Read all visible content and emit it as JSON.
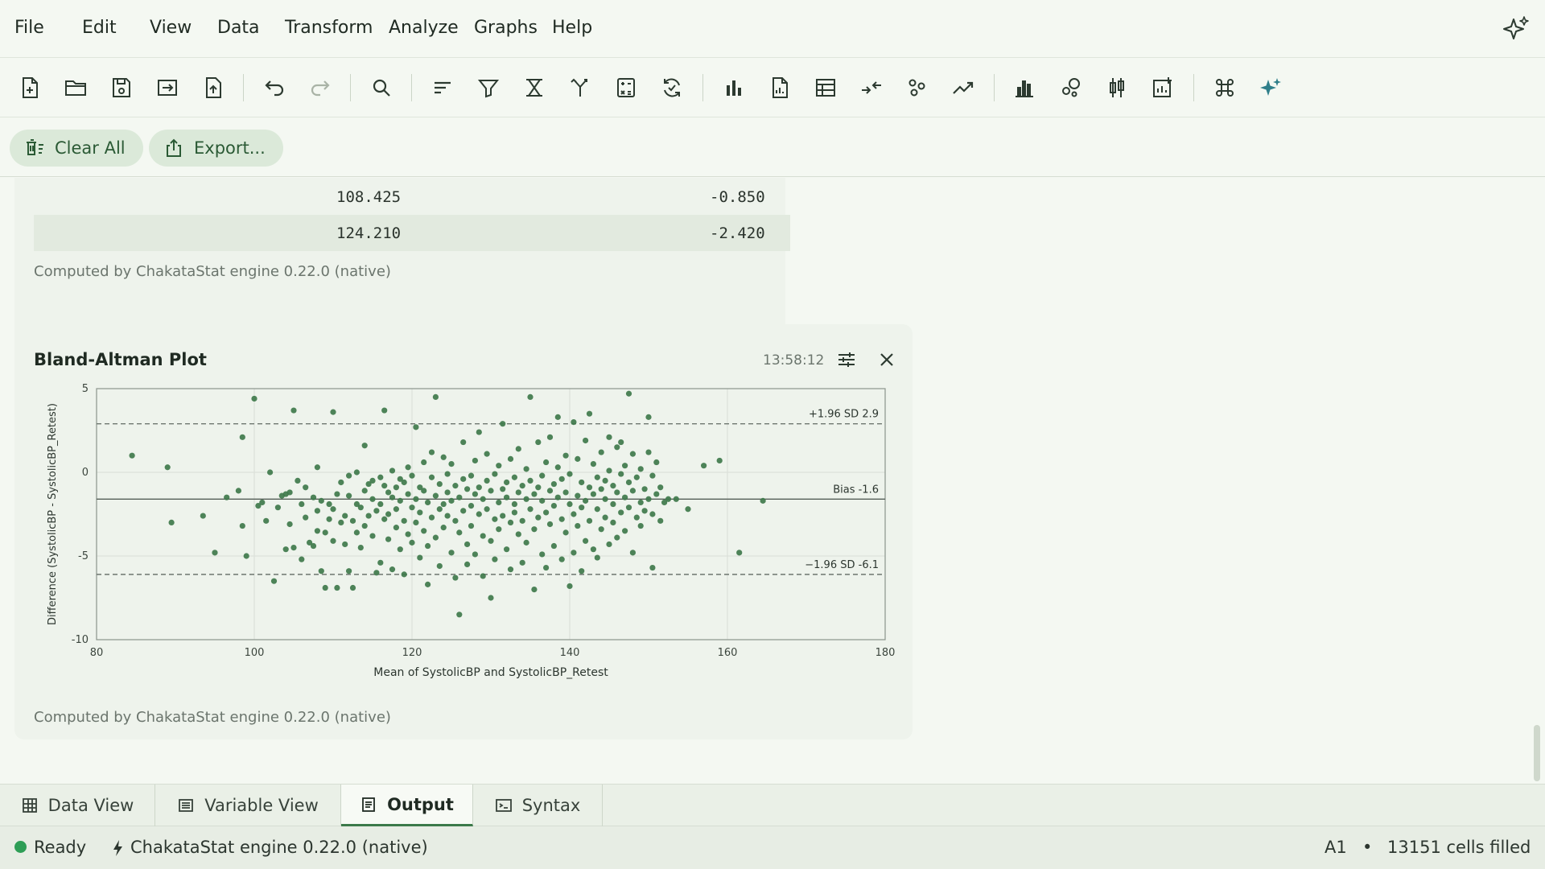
{
  "menu": [
    "File",
    "Edit",
    "View",
    "Data",
    "Transform",
    "Analyze",
    "Graphs",
    "Help"
  ],
  "toolbar_icons": [
    "new-file-icon",
    "open-folder-icon",
    "save-icon",
    "import-icon",
    "export-icon",
    "undo-icon",
    "redo-icon",
    "find-icon",
    "sort-icon",
    "filter-icon",
    "select-cases-icon",
    "split-file-icon",
    "compute-icon",
    "recode-icon",
    "bar-chart-icon",
    "report-icon",
    "table-icon",
    "merge-icon",
    "scatter-icon",
    "trend-icon",
    "histogram-icon",
    "bubble-icon",
    "boxplot-icon",
    "add-chart-icon",
    "command-icon",
    "ai-assist-icon"
  ],
  "actions": {
    "clear_all": "Clear All",
    "export": "Export..."
  },
  "table": {
    "rows": [
      {
        "mean": "108.425",
        "diff": "-0.850"
      },
      {
        "mean": "124.210",
        "diff": "-2.420"
      }
    ],
    "note": "Computed by ChakataStat engine 0.22.0 (native)"
  },
  "plot_card": {
    "title": "Bland-Altman Plot",
    "time": "13:58:12",
    "note": "Computed by ChakataStat engine 0.22.0 (native)"
  },
  "chart_data": {
    "type": "scatter",
    "title": "",
    "xlabel": "Mean of SystolicBP and SystolicBP_Retest",
    "ylabel": "Difference (SystolicBP - SystolicBP_Retest)",
    "xlim": [
      80,
      180
    ],
    "ylim": [
      -10,
      5
    ],
    "x_ticks": [
      "80",
      "100",
      "120",
      "140",
      "160",
      "180"
    ],
    "y_ticks": [
      "5",
      "0",
      "-5",
      "-10"
    ],
    "grid": true,
    "point_color": "#3f7a4b",
    "lines": [
      {
        "label": "+1.96 SD 2.9",
        "y": 2.9,
        "style": "dashed"
      },
      {
        "label": "Bias -1.6",
        "y": -1.6,
        "style": "solid"
      },
      {
        "label": "−1.96 SD -6.1",
        "y": -6.1,
        "style": "dashed"
      }
    ],
    "points": [
      [
        84.5,
        1
      ],
      [
        89,
        0.3
      ],
      [
        89.5,
        -3
      ],
      [
        93.5,
        -2.6
      ],
      [
        95,
        -4.8
      ],
      [
        96.5,
        -1.5
      ],
      [
        98,
        -1.1
      ],
      [
        98.5,
        -3.2
      ],
      [
        98.5,
        2.1
      ],
      [
        99,
        -5
      ],
      [
        100,
        4.4
      ],
      [
        100.5,
        -2
      ],
      [
        101,
        -1.8
      ],
      [
        101.5,
        -2.9
      ],
      [
        102,
        0
      ],
      [
        102.5,
        -6.5
      ],
      [
        103,
        -2.1
      ],
      [
        103.5,
        -1.4
      ],
      [
        104,
        -4.6
      ],
      [
        104,
        -1.3
      ],
      [
        104.5,
        -1.2
      ],
      [
        104.5,
        -3.1
      ],
      [
        105,
        -4.5
      ],
      [
        105,
        3.7
      ],
      [
        105.5,
        -0.5
      ],
      [
        106,
        -1.9
      ],
      [
        106,
        -5.2
      ],
      [
        106.5,
        -2.7
      ],
      [
        106.5,
        -0.9
      ],
      [
        107,
        -4.2
      ],
      [
        107.5,
        -4.4
      ],
      [
        107.5,
        -1.5
      ],
      [
        108,
        -2.3
      ],
      [
        108,
        -3.5
      ],
      [
        108,
        0.3
      ],
      [
        108.5,
        -1.7
      ],
      [
        108.5,
        -5.9
      ],
      [
        109,
        -6.9
      ],
      [
        109,
        -3.6
      ],
      [
        109.5,
        -2.8
      ],
      [
        109.5,
        -1.9
      ],
      [
        110,
        -4.1
      ],
      [
        110,
        -2.2
      ],
      [
        110,
        3.6
      ],
      [
        110.5,
        -1.3
      ],
      [
        110.5,
        -6.9
      ],
      [
        111,
        -0.6
      ],
      [
        111,
        -3
      ],
      [
        111.5,
        -2.6
      ],
      [
        111.5,
        -4.3
      ],
      [
        112,
        -5.9
      ],
      [
        112,
        -1.4
      ],
      [
        112,
        -0.2
      ],
      [
        112.5,
        -2.9
      ],
      [
        112.5,
        -6.9
      ],
      [
        113,
        -1.9
      ],
      [
        113,
        -3.6
      ],
      [
        113,
        0
      ],
      [
        113.5,
        -4.5
      ],
      [
        113.5,
        -2.1
      ],
      [
        114,
        -1.1
      ],
      [
        114,
        -3.2
      ],
      [
        114,
        1.6
      ],
      [
        114.5,
        -2.6
      ],
      [
        114.5,
        -0.7
      ],
      [
        115,
        -0.5
      ],
      [
        115,
        -3.8
      ],
      [
        115,
        -1.6
      ],
      [
        115.5,
        -6
      ],
      [
        115.5,
        -2.3
      ],
      [
        116,
        -0.3
      ],
      [
        116,
        -1.9
      ],
      [
        116,
        -5.4
      ],
      [
        116.5,
        -2.8
      ],
      [
        116.5,
        -0.8
      ],
      [
        116.5,
        3.7
      ],
      [
        117,
        -1.2
      ],
      [
        117,
        -4
      ],
      [
        117,
        -2.5
      ],
      [
        117.5,
        0.1
      ],
      [
        117.5,
        -1.5
      ],
      [
        117.5,
        -5.8
      ],
      [
        118,
        -0.9
      ],
      [
        118,
        -3.3
      ],
      [
        118,
        -2.2
      ],
      [
        118.5,
        -0.4
      ],
      [
        118.5,
        -4.6
      ],
      [
        118.5,
        -1.7
      ],
      [
        119,
        -2.9
      ],
      [
        119,
        -0.6
      ],
      [
        119,
        -6.1
      ],
      [
        119.5,
        -1.3
      ],
      [
        119.5,
        -3.7
      ],
      [
        119.5,
        0.3
      ],
      [
        120,
        -2.1
      ],
      [
        120,
        -4.2
      ],
      [
        120,
        -0.2
      ],
      [
        120.5,
        -1.6
      ],
      [
        120.5,
        -3
      ],
      [
        120.5,
        2.7
      ],
      [
        121,
        -0.9
      ],
      [
        121,
        -5.1
      ],
      [
        121,
        -2.4
      ],
      [
        121.5,
        -1.1
      ],
      [
        121.5,
        -3.5
      ],
      [
        121.5,
        0.6
      ],
      [
        122,
        -1.8
      ],
      [
        122,
        -6.7
      ],
      [
        122,
        -4.4
      ],
      [
        122.5,
        -0.3
      ],
      [
        122.5,
        -2.7
      ],
      [
        122.5,
        1.2
      ],
      [
        123,
        -1.4
      ],
      [
        123,
        -3.9
      ],
      [
        123,
        4.5
      ],
      [
        123.5,
        -0.7
      ],
      [
        123.5,
        -2.2
      ],
      [
        123.5,
        -5.6
      ],
      [
        124,
        -1.9
      ],
      [
        124,
        0.9
      ],
      [
        124,
        -3.3
      ],
      [
        124.5,
        -1.2
      ],
      [
        124.5,
        -2.6
      ],
      [
        124.5,
        -0.1
      ],
      [
        125,
        -4.8
      ],
      [
        125,
        -1.7
      ],
      [
        125,
        0.5
      ],
      [
        125.5,
        -2.9
      ],
      [
        125.5,
        -0.8
      ],
      [
        125.5,
        -6.3
      ],
      [
        126,
        -1.5
      ],
      [
        126,
        -3.6
      ],
      [
        126,
        -8.5
      ],
      [
        126.5,
        -0.4
      ],
      [
        126.5,
        -2.3
      ],
      [
        126.5,
        1.8
      ],
      [
        127,
        -1
      ],
      [
        127,
        -4.3
      ],
      [
        127,
        -5.5
      ],
      [
        127.5,
        -2
      ],
      [
        127.5,
        -0.2
      ],
      [
        127.5,
        -3.2
      ],
      [
        128,
        -1.3
      ],
      [
        128,
        0.7
      ],
      [
        128,
        -4.9
      ],
      [
        128.5,
        -2.5
      ],
      [
        128.5,
        -0.9
      ],
      [
        128.5,
        2.4
      ],
      [
        129,
        -1.6
      ],
      [
        129,
        -3.8
      ],
      [
        129,
        -6.2
      ],
      [
        129.5,
        -0.5
      ],
      [
        129.5,
        -2.2
      ],
      [
        129.5,
        1.1
      ],
      [
        130,
        -1.1
      ],
      [
        130,
        -4.1
      ],
      [
        130,
        -7.5
      ],
      [
        130.5,
        -2.8
      ],
      [
        130.5,
        -0.1
      ],
      [
        130.5,
        -5.2
      ],
      [
        131,
        -1.8
      ],
      [
        131,
        0.4
      ],
      [
        131,
        -3.4
      ],
      [
        131.5,
        -1
      ],
      [
        131.5,
        -2.6
      ],
      [
        131.5,
        2.9
      ],
      [
        132,
        -0.6
      ],
      [
        132,
        -4.6
      ],
      [
        132,
        -1.5
      ],
      [
        132.5,
        -3
      ],
      [
        132.5,
        0.8
      ],
      [
        132.5,
        -5.8
      ],
      [
        133,
        -1.9
      ],
      [
        133,
        -0.3
      ],
      [
        133,
        -2.4
      ],
      [
        133.5,
        -1.2
      ],
      [
        133.5,
        -3.7
      ],
      [
        133.5,
        1.4
      ],
      [
        134,
        -0.8
      ],
      [
        134,
        -2.9
      ],
      [
        134,
        -5.4
      ],
      [
        134.5,
        -1.6
      ],
      [
        134.5,
        0.2
      ],
      [
        134.5,
        -4.2
      ],
      [
        135,
        -2.2
      ],
      [
        135,
        -0.5
      ],
      [
        135,
        4.5
      ],
      [
        135.5,
        -1.3
      ],
      [
        135.5,
        -3.4
      ],
      [
        135.5,
        -7
      ],
      [
        136,
        -0.9
      ],
      [
        136,
        -2.7
      ],
      [
        136,
        1.8
      ],
      [
        136.5,
        -1.7
      ],
      [
        136.5,
        -4.9
      ],
      [
        136.5,
        -0.2
      ],
      [
        137,
        -2.4
      ],
      [
        137,
        0.6
      ],
      [
        137,
        -5.7
      ],
      [
        137.5,
        -1.1
      ],
      [
        137.5,
        -3.1
      ],
      [
        137.5,
        2.1
      ],
      [
        138,
        -0.7
      ],
      [
        138,
        -2
      ],
      [
        138,
        -4.4
      ],
      [
        138.5,
        -1.5
      ],
      [
        138.5,
        0.3
      ],
      [
        138.5,
        3.3
      ],
      [
        139,
        -2.8
      ],
      [
        139,
        -0.4
      ],
      [
        139,
        -5.2
      ],
      [
        139.5,
        -1.2
      ],
      [
        139.5,
        -3.6
      ],
      [
        139.5,
        1
      ],
      [
        140,
        -1.9
      ],
      [
        140,
        -0.1
      ],
      [
        140,
        -6.8
      ],
      [
        140.5,
        -2.5
      ],
      [
        140.5,
        -4.8
      ],
      [
        140.5,
        3
      ],
      [
        141,
        -1.4
      ],
      [
        141,
        0.8
      ],
      [
        141,
        -3.2
      ],
      [
        141.5,
        -0.6
      ],
      [
        141.5,
        -2.1
      ],
      [
        141.5,
        -5.9
      ],
      [
        142,
        -1.7
      ],
      [
        142,
        -4.1
      ],
      [
        142,
        1.9
      ],
      [
        142.5,
        -0.9
      ],
      [
        142.5,
        -2.9
      ],
      [
        142.5,
        3.5
      ],
      [
        143,
        -1.3
      ],
      [
        143,
        0.5
      ],
      [
        143,
        -4.6
      ],
      [
        143.5,
        -2.2
      ],
      [
        143.5,
        -0.3
      ],
      [
        143.5,
        -5.1
      ],
      [
        144,
        -1
      ],
      [
        144,
        -3.4
      ],
      [
        144,
        1.2
      ],
      [
        144.5,
        -1.6
      ],
      [
        144.5,
        -2.7
      ],
      [
        144.5,
        -0.5
      ],
      [
        145,
        0.1
      ],
      [
        145,
        -4.3
      ],
      [
        145,
        2.1
      ],
      [
        145.5,
        -1.9
      ],
      [
        145.5,
        -3
      ],
      [
        145.5,
        -0.8
      ],
      [
        146,
        -1.2
      ],
      [
        146,
        1.5
      ],
      [
        146,
        -3.9
      ],
      [
        146.5,
        -2.4
      ],
      [
        146.5,
        -0.1
      ],
      [
        146.5,
        1.8
      ],
      [
        147,
        -1.5
      ],
      [
        147,
        -3.5
      ],
      [
        147,
        0.4
      ],
      [
        147.5,
        -2.1
      ],
      [
        147.5,
        -0.6
      ],
      [
        147.5,
        4.7
      ],
      [
        148,
        -1.1
      ],
      [
        148,
        -4.8
      ],
      [
        148,
        1.1
      ],
      [
        148.5,
        -2.7
      ],
      [
        148.5,
        -0.3
      ],
      [
        149,
        -1.8
      ],
      [
        149,
        -3.2
      ],
      [
        149,
        0.2
      ],
      [
        149.5,
        -1
      ],
      [
        149.5,
        -2.3
      ],
      [
        150,
        1.2
      ],
      [
        150,
        -1.6
      ],
      [
        150,
        3.3
      ],
      [
        150.5,
        -0.2
      ],
      [
        150.5,
        -2.5
      ],
      [
        150.5,
        -5.7
      ],
      [
        151,
        0.6
      ],
      [
        151,
        -1.3
      ],
      [
        151.5,
        -0.9
      ],
      [
        151.5,
        -2.9
      ],
      [
        152,
        -1.8
      ],
      [
        152.5,
        -1.6
      ],
      [
        153.5,
        -1.6
      ],
      [
        155,
        -2.2
      ],
      [
        157,
        0.4
      ],
      [
        159,
        0.7
      ],
      [
        161.5,
        -4.8
      ],
      [
        164.5,
        -1.7
      ]
    ]
  },
  "tabs": [
    "Data View",
    "Variable View",
    "Output",
    "Syntax"
  ],
  "status": {
    "ready": "Ready",
    "engine": "ChakataStat engine 0.22.0 (native)",
    "cell": "A1",
    "sep": "•",
    "filled": "13151 cells filled"
  }
}
